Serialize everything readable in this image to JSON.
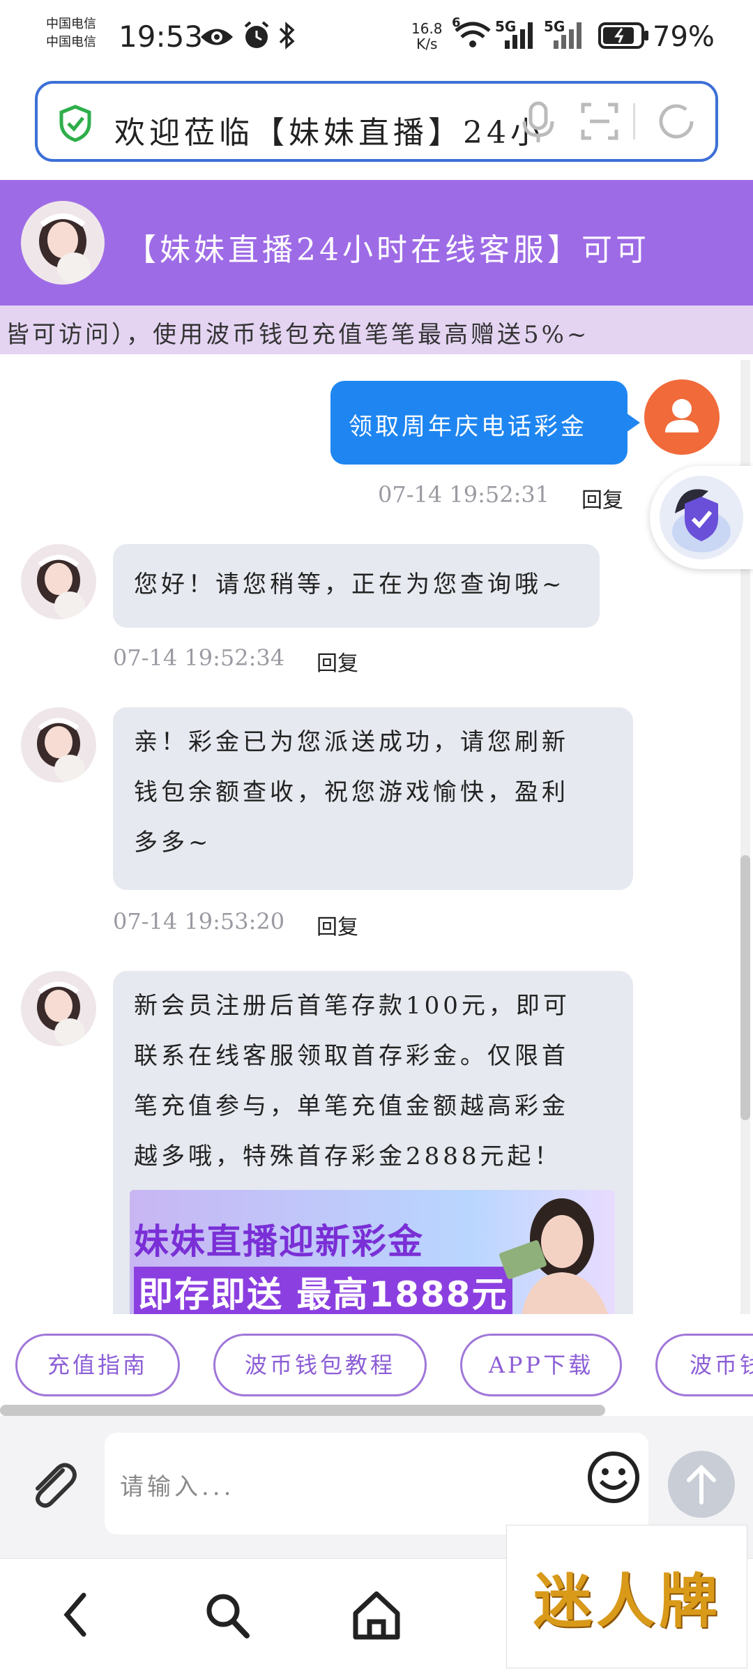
{
  "status_bar": {
    "carrier_1": "中国电信",
    "carrier_2": "中国电信",
    "time": "19:53",
    "network_speed_value": "16.8",
    "network_speed_unit": "K/s",
    "wifi_label": "6",
    "signal_1_label": "5G",
    "signal_2_label": "5G",
    "battery_percent": "79%"
  },
  "search": {
    "text": "欢迎莅临【妹妹直播】24小"
  },
  "header": {
    "title": "【妹妹直播24小时在线客服】可可",
    "marquee": "皆可访问），使用波币钱包充值笔笔最高赠送5%~"
  },
  "messages": {
    "outgoing": {
      "text": "领取周年庆电话彩金",
      "time": "07-14 19:52:31",
      "reply_label": "回复"
    },
    "incoming": [
      {
        "lines": [
          "您好！请您稍等，正在为您查询哦~"
        ],
        "time": "07-14 19:52:34",
        "reply_label": "回复"
      },
      {
        "lines": [
          "亲！彩金已为您派送成功，请您刷新",
          "钱包余额查收，祝您游戏愉快，盈利",
          "多多~"
        ],
        "time": "07-14 19:53:20",
        "reply_label": "回复"
      },
      {
        "lines": [
          "新会员注册后首笔存款100元，即可",
          "联系在线客服领取首存彩金。仅限首",
          "笔充值参与，单笔充值金额越高彩金",
          "越多哦，特殊首存彩金2888元起！"
        ],
        "banner_line_1": "妹妹直播迎新彩金",
        "banner_line_2": "即存即送 最高1888元"
      }
    ]
  },
  "quick_actions": [
    "充值指南",
    "波币钱包教程",
    "APP下载",
    "波币钱"
  ],
  "input": {
    "placeholder": "请输入..."
  },
  "watermark": {
    "logo_text": "迷人牌"
  },
  "colors": {
    "header_purple": "#9e6be6",
    "marquee_bg": "#e4d4f2",
    "outgoing_bubble": "#1f86f1",
    "incoming_bubble": "#e6e9ef",
    "user_avatar": "#f06a3a",
    "chip_border": "#a077d8",
    "search_border": "#3d6fd6"
  },
  "icons": {
    "status": [
      "eye-icon",
      "alarm-icon",
      "bluetooth-icon",
      "wifi-icon",
      "signal-icon",
      "battery-icon"
    ],
    "search": [
      "shield-check-icon",
      "microphone-icon",
      "scan-icon",
      "refresh-icon"
    ],
    "input": [
      "paperclip-icon",
      "emoji-icon",
      "send-arrow-icon"
    ],
    "nav": [
      "back-icon",
      "search-icon",
      "home-icon"
    ]
  }
}
